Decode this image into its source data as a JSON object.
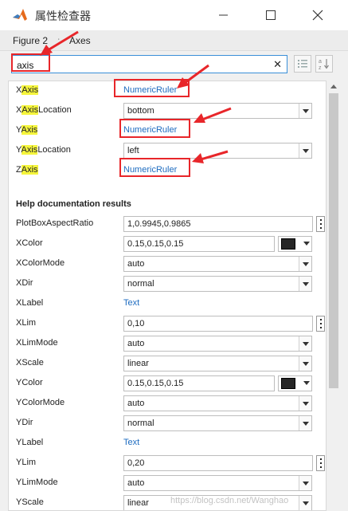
{
  "window": {
    "title": "属性检查器",
    "minimize_icon": "minimize-icon",
    "maximize_icon": "maximize-icon",
    "close_icon": "close-icon"
  },
  "breadcrumb": {
    "figure": "Figure 2",
    "separator": ":",
    "object": "Axes"
  },
  "search": {
    "value": "axis",
    "clear_glyph": "✕"
  },
  "toolbar": {
    "categorized_icon": "list-categories-icon",
    "sort_icon": "sort-az-icon"
  },
  "matches": [
    {
      "pre": "X",
      "hl": "Axis",
      "post": "",
      "value": "NumericRuler"
    },
    {
      "pre": "X",
      "hl": "Axis",
      "post": "Location",
      "value": "bottom"
    },
    {
      "pre": "Y",
      "hl": "Axis",
      "post": "",
      "value": "NumericRuler"
    },
    {
      "pre": "Y",
      "hl": "Axis",
      "post": "Location",
      "value": "left"
    },
    {
      "pre": "Z",
      "hl": "Axis",
      "post": "",
      "value": "NumericRuler"
    }
  ],
  "help_section": {
    "title": "Help documentation results"
  },
  "properties": [
    {
      "name": "PlotBoxAspectRatio",
      "value": "1,0.9945,0.9865"
    },
    {
      "name": "XColor",
      "value": "0.15,0.15,0.15"
    },
    {
      "name": "XColorMode",
      "value": "auto"
    },
    {
      "name": "XDir",
      "value": "normal"
    },
    {
      "name": "XLabel",
      "value": "Text"
    },
    {
      "name": "XLim",
      "value": "0,10"
    },
    {
      "name": "XLimMode",
      "value": "auto"
    },
    {
      "name": "XScale",
      "value": "linear"
    },
    {
      "name": "YColor",
      "value": "0.15,0.15,0.15"
    },
    {
      "name": "YColorMode",
      "value": "auto"
    },
    {
      "name": "YDir",
      "value": "normal"
    },
    {
      "name": "YLabel",
      "value": "Text"
    },
    {
      "name": "YLim",
      "value": "0,20"
    },
    {
      "name": "YLimMode",
      "value": "auto"
    },
    {
      "name": "YScale",
      "value": "linear"
    }
  ],
  "colors": {
    "accent": "#3a8fd8",
    "link": "#1e6cc0",
    "highlight": "#f5f53c",
    "annotation": "#e8262a",
    "swatch": "#262626"
  },
  "watermark": "https://blog.csdn.net/Wanghao"
}
